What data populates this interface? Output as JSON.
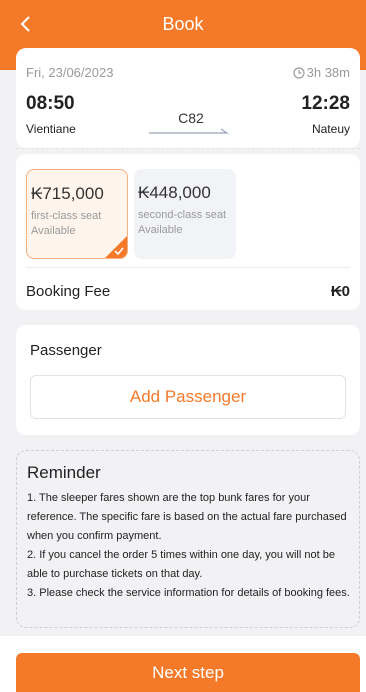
{
  "header": {
    "title": "Book",
    "back_icon": "chevron-left-icon"
  },
  "trip": {
    "date": "Fri, 23/06/2023",
    "duration": "3h 38m",
    "duration_icon": "clock-icon",
    "departure_time": "08:50",
    "departure_station": "Vientiane",
    "arrival_time": "12:28",
    "arrival_station": "Nateuy",
    "train_number": "C82"
  },
  "seats": [
    {
      "price": "₭715,000",
      "class": "first-class seat",
      "status": "Available",
      "selected": true
    },
    {
      "price": "₭448,000",
      "class": "second-class seat",
      "status": "Available",
      "selected": false
    }
  ],
  "booking_fee": {
    "label": "Booking Fee",
    "value": "₭0"
  },
  "passenger": {
    "title": "Passenger",
    "add_label": "Add Passenger"
  },
  "reminder": {
    "title": "Reminder",
    "items": [
      "1. The sleeper fares shown are the top bunk fares for your reference. The specific fare is based on the actual fare purchased when you confirm payment.",
      "2. If you cancel the order 5 times within one day, you will not be able to purchase tickets on that day.",
      "3. Please check the service information for details of booking fees."
    ]
  },
  "footer": {
    "next_label": "Next step"
  },
  "colors": {
    "accent": "#f47a2a",
    "background": "#f2f2f5"
  }
}
